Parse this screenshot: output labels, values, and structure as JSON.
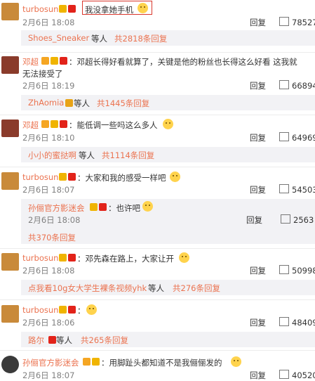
{
  "comments": [
    {
      "user": "turbosun",
      "text": "我没拿她手机",
      "date": "2月6日 18:08",
      "reply": "回复",
      "likes": "78527",
      "sub_prefix": "Shoes_Sneaker",
      "sub_mid": " 等人 ",
      "sub_count": "共2818条回复"
    },
    {
      "user": "邓超",
      "text": "：邓超长得好看就算了，关键是他的粉丝也长得这么好看 这我就",
      "text2": "无法接受了",
      "date": "2月6日 18:19",
      "reply": "回复",
      "likes": "66894",
      "sub_prefix": "ZhAomia",
      "sub_mid": " 等人 ",
      "sub_count": "共1445条回复"
    },
    {
      "user": "邓超",
      "text": "：能低调一些吗这么多人",
      "date": "2月6日 18:10",
      "reply": "回复",
      "likes": "64969",
      "sub_prefix": "小小的蜜挞啊",
      "sub_mid": " 等人 ",
      "sub_count": "共1114条回复"
    },
    {
      "user": "turbosun",
      "text": "：大家和我的感受一样吧",
      "date": "2月6日 18:07",
      "reply": "回复",
      "likes": "54503",
      "nested": {
        "user": "孙俪官方影迷会",
        "text": "：也许吧",
        "date": "2月6日 18:08",
        "reply": "回复",
        "likes": "2563"
      },
      "sub_count": "共370条回复"
    },
    {
      "user": "turbosun",
      "text": "：邓先森在路上，大家让开",
      "date": "2月6日 18:08",
      "reply": "回复",
      "likes": "50998",
      "sub_prefix": "点我看10g女大学生裸条视频yhk",
      "sub_mid": " 等人 ",
      "sub_count": "共276条回复"
    },
    {
      "user": "turbosun",
      "text": "：",
      "date": "2月6日 18:06",
      "reply": "回复",
      "likes": "48409",
      "sub_prefix": "路尔",
      "sub_mid": " 等人 ",
      "sub_count": "共265条回复"
    },
    {
      "user": "孙俪官方影迷会",
      "text": "：用脚趾头都知道不是我俪俪发的",
      "date": "2月6日 18:07",
      "reply": "回复",
      "likes": "40520"
    }
  ],
  "colors": {
    "username": "#eb7350",
    "accent": "#eb7350",
    "text": "#333333",
    "date": "#808080",
    "panel": "#f2f2f5"
  }
}
